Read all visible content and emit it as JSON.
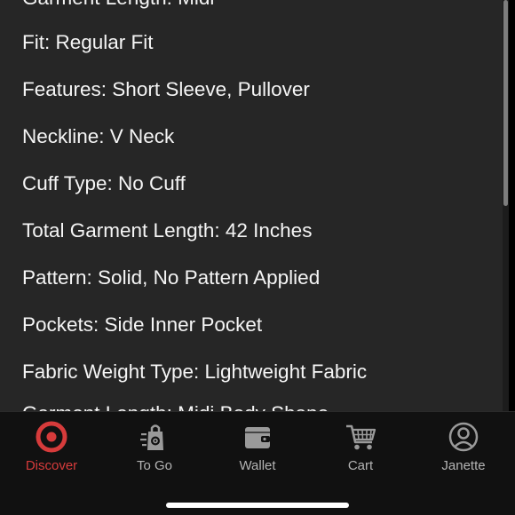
{
  "spec_lines": [
    "Garment Length: Midi",
    "Fit: Regular Fit",
    "Features: Short Sleeve, Pullover",
    "Neckline: V Neck",
    "Cuff Type: No Cuff",
    "Total Garment Length: 42 Inches",
    "Pattern: Solid, No Pattern Applied",
    "Pockets: Side Inner Pocket",
    "Fabric Weight Type: Lightweight Fabric",
    "Garment Length: Midi Body Shape"
  ],
  "tabbar": {
    "tabs": [
      {
        "label": "Discover",
        "icon": "target-bullseye-icon",
        "active": true
      },
      {
        "label": "To Go",
        "icon": "shopping-bag-icon",
        "active": false
      },
      {
        "label": "Wallet",
        "icon": "wallet-icon",
        "active": false
      },
      {
        "label": "Cart",
        "icon": "cart-icon",
        "active": false
      },
      {
        "label": "Janette",
        "icon": "user-icon",
        "active": false
      }
    ]
  },
  "colors": {
    "content_background": "#262626",
    "tabbar_background": "#111111",
    "active_tab": "#d63b3b",
    "inactive_tab": "#b4b4b4",
    "text": "#f5f5f5"
  }
}
